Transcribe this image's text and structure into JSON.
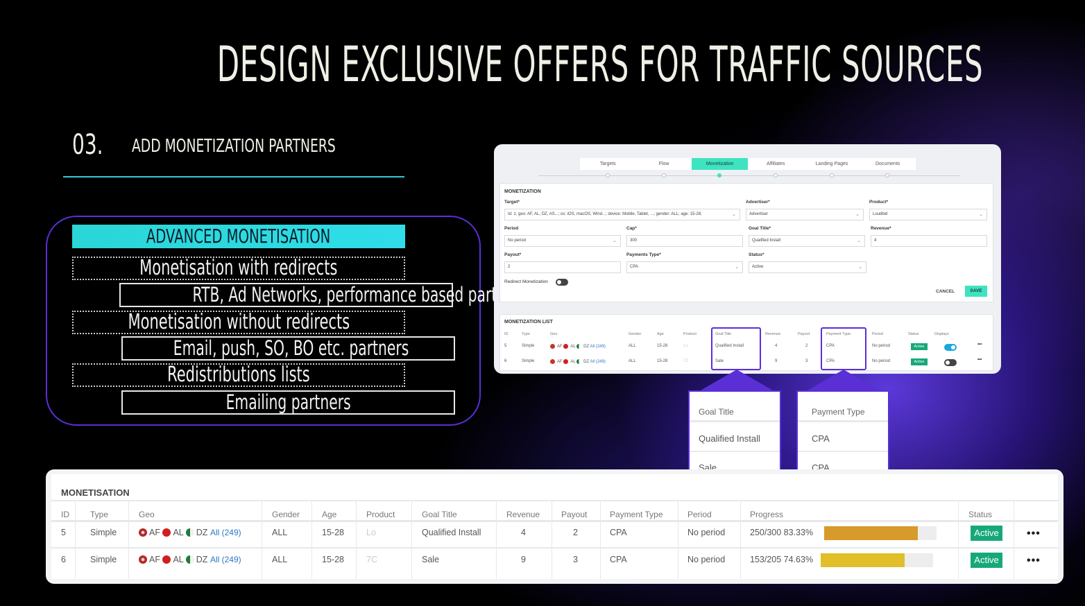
{
  "slide": {
    "title": "DESIGN EXCLUSIVE OFFERS FOR TRAFFIC SOURCES",
    "step_number": "03.",
    "step_label": "ADD MONETIZATION PARTNERS",
    "colors": {
      "accent_cyan": "#2ad6d6",
      "accent_purple": "#5a2fd6",
      "status_green": "#17a87a"
    }
  },
  "advanced": {
    "heading": "ADVANCED MONETISATION",
    "items": [
      "Monetisation with redirects",
      "RTB,  Ad Networks, performance based partners",
      "Monetisation without redirects",
      "Email, push, SO, BO etc. partners",
      "Redistributions lists",
      "Emailing partners"
    ]
  },
  "app": {
    "tabs": [
      "Targets",
      "Flow",
      "Monetization",
      "Affiliates",
      "Landing Pages",
      "Documents"
    ],
    "active_tab": "Monetization",
    "form": {
      "section_title": "MONETIZATION",
      "target_label": "Target*",
      "target_value": "Id: 1; geo: AF, AL, DZ, AS...; os: iOS, macOS, Wind...; device: Mobile, Tablet, ...; gender: ALL; age: 15-28;",
      "advertiser_label": "Advertiser*",
      "advertiser_value": "Advertiser",
      "product_label": "Product*",
      "product_value": "Loudbid",
      "period_label": "Period",
      "period_value": "No period",
      "cap_label": "Cap*",
      "cap_value": "300",
      "goal_label": "Goal Title*",
      "goal_value": "Qualified Install",
      "revenue_label": "Revenue*",
      "revenue_value": "4",
      "payout_label": "Payout*",
      "payout_value": "2",
      "payments_type_label": "Payments Type*",
      "payments_type_value": "CPA",
      "status_label": "Status*",
      "status_value": "Active",
      "redirect_label": "Redirect Monetization",
      "cancel_label": "CANCEL",
      "save_label": "SAVE"
    },
    "list": {
      "title": "MONETIZATION LIST",
      "headers": [
        "ID",
        "Type",
        "Geo",
        "Gender",
        "Age",
        "Product",
        "Goal Title",
        "Revenue",
        "Payout",
        "Payment Type",
        "Period",
        "Status",
        "Displays"
      ],
      "rows": [
        {
          "id": "5",
          "type": "Simple",
          "geo_af": "AF",
          "geo_al": "AL",
          "geo_dz": "DZ",
          "all": "All (249)",
          "gender": "ALL",
          "age": "15-28",
          "product": "Lo",
          "goal": "Qualified Install",
          "revenue": "4",
          "payout": "2",
          "payment_type": "CPA",
          "period": "No period",
          "status": "Active",
          "display_on": true
        },
        {
          "id": "6",
          "type": "Simple",
          "geo_af": "AF",
          "geo_al": "AL",
          "geo_dz": "DZ",
          "all": "All (249)",
          "gender": "ALL",
          "age": "15-28",
          "product": "7C",
          "goal": "Sale",
          "revenue": "9",
          "payout": "3",
          "payment_type": "CPA",
          "period": "No period",
          "status": "Active",
          "display_on": false
        }
      ]
    }
  },
  "callouts": {
    "goal": {
      "header": "Goal Title",
      "rows": [
        "Qualified Install",
        "Sale"
      ]
    },
    "payment": {
      "header": "Payment Type",
      "rows": [
        "CPA",
        "CPA"
      ]
    }
  },
  "monetisation_table": {
    "title": "MONETISATION",
    "headers": [
      "ID",
      "Type",
      "Geo",
      "Gender",
      "Age",
      "Product",
      "Goal Title",
      "Revenue",
      "Payout",
      "Payment Type",
      "Period",
      "Progress",
      "Status"
    ],
    "rows": [
      {
        "id": "5",
        "type": "Simple",
        "geo_af": "AF",
        "geo_al": "AL",
        "geo_dz": "DZ",
        "all": "All (249)",
        "gender": "ALL",
        "age": "15-28",
        "product": "Lo",
        "goal": "Qualified Install",
        "revenue": "4",
        "payout": "2",
        "payment_type": "CPA",
        "period": "No period",
        "progress_text": "250/300 83.33%",
        "progress": 0.8333,
        "bar_color": "#d89a2a",
        "status": "Active"
      },
      {
        "id": "6",
        "type": "Simple",
        "geo_af": "AF",
        "geo_al": "AL",
        "geo_dz": "DZ",
        "all": "All (249)",
        "gender": "ALL",
        "age": "15-28",
        "product": "7C",
        "goal": "Sale",
        "revenue": "9",
        "payout": "3",
        "payment_type": "CPA",
        "period": "No period",
        "progress_text": "153/205 74.63%",
        "progress": 0.7463,
        "bar_color": "#e0bf2a",
        "status": "Active"
      }
    ],
    "more_icon": "more-horizontal-icon"
  }
}
